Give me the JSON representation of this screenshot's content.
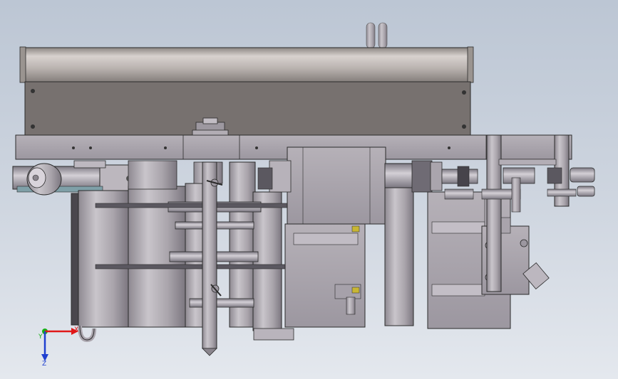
{
  "viewport": {
    "background_top": "#bcc6d4",
    "background_bottom": "#e4e8ee"
  },
  "colors": {
    "body_metal": "#a9a4ab",
    "dark_panel": "#77716f",
    "tube_light": "#d9d3d1",
    "edge": "#2b2b2b",
    "axis_x": "#e01818",
    "axis_y": "#18b018",
    "axis_z": "#2040d0"
  },
  "triad": {
    "x_label": "X",
    "y_label": "Y",
    "z_label": "Z"
  }
}
